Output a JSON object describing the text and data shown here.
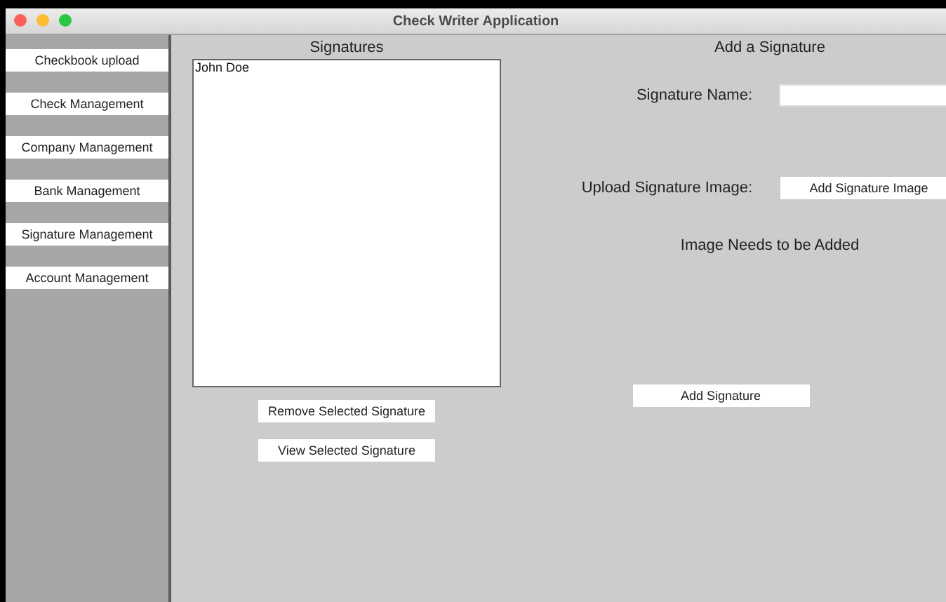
{
  "window": {
    "title": "Check Writer Application"
  },
  "sidebar": {
    "items": [
      {
        "label": "Checkbook upload"
      },
      {
        "label": "Check Management"
      },
      {
        "label": "Company Management"
      },
      {
        "label": "Bank Management"
      },
      {
        "label": "Signature Management"
      },
      {
        "label": "Account Management"
      }
    ]
  },
  "signatures": {
    "heading": "Signatures",
    "items": [
      "John Doe"
    ],
    "buttons": [
      "Remove Selected Signature",
      "View Selected Signature"
    ]
  },
  "add_signature": {
    "heading": "Add a Signature",
    "name_label": "Signature Name:",
    "upload_label": "Upload Signature Image:",
    "upload_button": "Add Signature Image",
    "image_status": "Image Needs to be Added",
    "submit_button": "Add Signature"
  }
}
